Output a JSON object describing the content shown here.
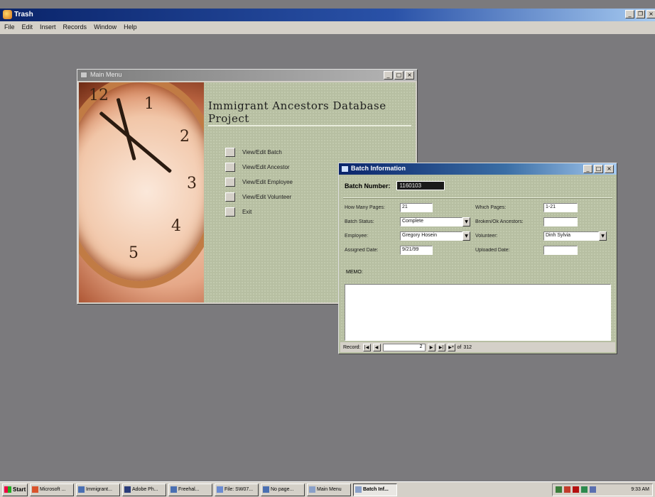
{
  "app": {
    "title": "Trash"
  },
  "menubar": [
    "File",
    "Edit",
    "Insert",
    "Records",
    "Window",
    "Help"
  ],
  "main_menu": {
    "title": "Main Menu",
    "heading": "Immigrant Ancestors Database Project",
    "items": [
      "View/Edit Batch",
      "View/Edit Ancestor",
      "View/Edit Employee",
      "View/Edit Volunteer",
      "Exit"
    ]
  },
  "batch": {
    "title": "Batch Information",
    "batch_number_label": "Batch Number:",
    "batch_number_value": "1160103",
    "fields": {
      "how_many_pages": {
        "label": "How Many Pages:",
        "value": "21"
      },
      "which_pages": {
        "label": "Which Pages:",
        "value": "1-21"
      },
      "batch_status": {
        "label": "Batch Status:",
        "value": "Complete"
      },
      "broken_ancestor": {
        "label": "Broken/Ok Ancestors:",
        "value": ""
      },
      "employee": {
        "label": "Employee:",
        "value": "Gregory Hosein"
      },
      "volunteer": {
        "label": "Volunteer:",
        "value": "Dinh Sylvia"
      },
      "assigned_date": {
        "label": "Assigned Date:",
        "value": "9/21/99"
      },
      "uploaded_date": {
        "label": "Uploaded Date:",
        "value": ""
      }
    },
    "memo_label": "MEMO:",
    "nav": {
      "record_label": "Record:",
      "current": "2",
      "of_label": "of",
      "total": "312"
    }
  },
  "taskbar": {
    "start_label": "Start",
    "tasks": [
      "Microsoft ...",
      "Immigrant...",
      "Adobe Ph...",
      "Freehal...",
      "File: SW07...",
      "No page...",
      "Main Menu",
      "Batch Inf..."
    ],
    "active_index": 7,
    "clock": "9:33 AM"
  }
}
